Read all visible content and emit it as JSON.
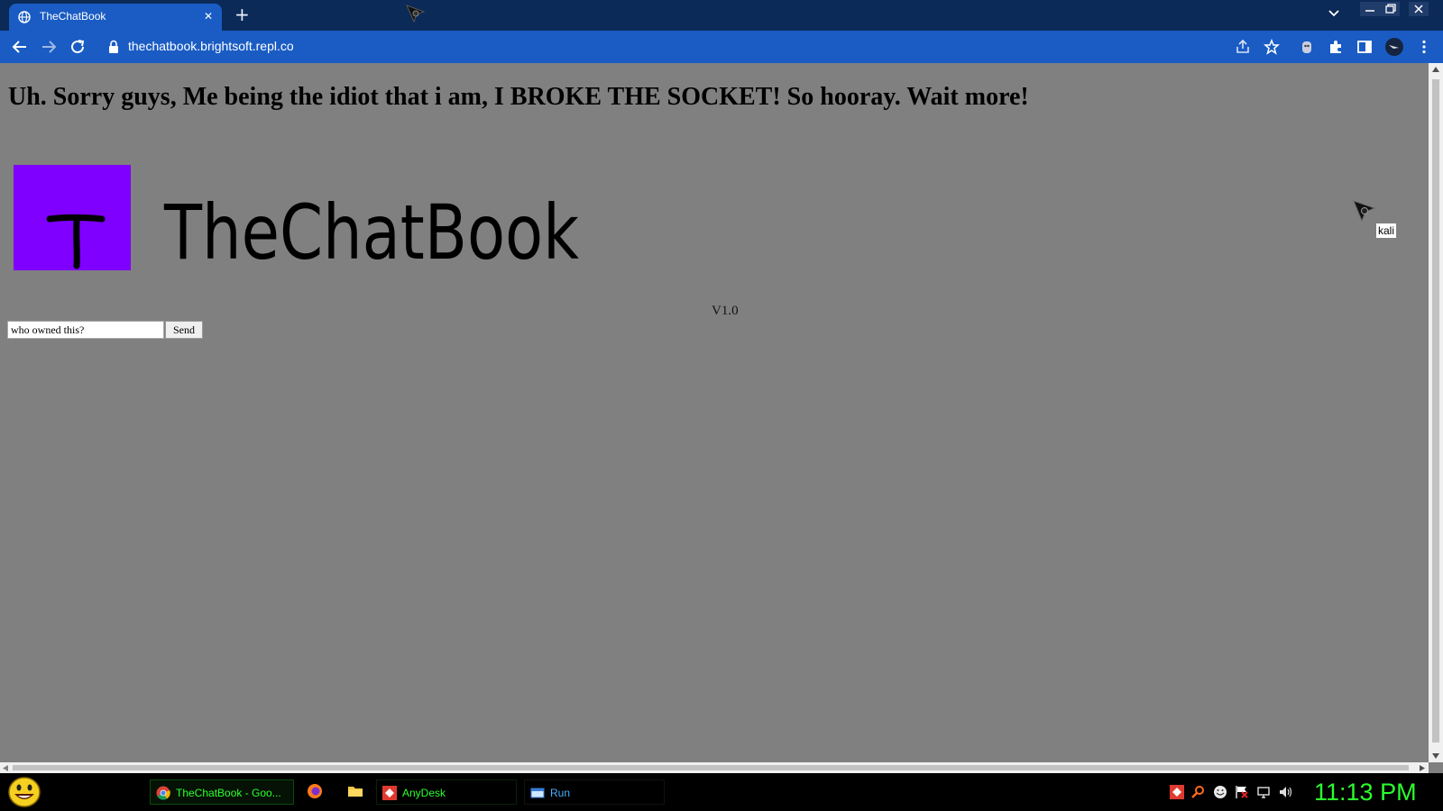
{
  "browser": {
    "tab": {
      "title": "TheChatBook",
      "favicon": "globe-icon",
      "close_icon": "close-icon"
    },
    "new_tab_icon": "plus-icon",
    "address": {
      "url": "thechatbook.brightsoft.repl.co",
      "lock_icon": "lock-icon"
    },
    "nav_icons": [
      "back-arrow-icon",
      "forward-arrow-icon",
      "reload-icon"
    ],
    "toolbar_icons": [
      "share-icon",
      "bookmark-star-icon",
      "extension-mascot-icon",
      "puzzle-extensions-icon",
      "side-panel-icon",
      "profile-avatar-icon",
      "more-menu-icon"
    ],
    "window_controls": [
      "minimize-icon",
      "restore-icon",
      "close-window-icon"
    ],
    "accent_color": "#1a5cc4",
    "titlebar_color": "#0b2a57"
  },
  "page": {
    "headline": "Uh. Sorry guys, Me being the idiot that i am, I BROKE THE SOCKET! So hooray. Wait more!",
    "logo": {
      "letter": "T",
      "wordmark": "TheChatBook",
      "box_color": "#7f00ff"
    },
    "version": "V1.0",
    "chat_input_value": "who owned this?",
    "send_label": "Send",
    "remote_cursor_label": "kali",
    "background_color": "#808080"
  },
  "taskbar": {
    "start_icon": "smiley-start-icon",
    "items": [
      {
        "label": "TheChatBook - Goo...",
        "icon": "chrome-icon"
      },
      {
        "label": "AnyDesk",
        "icon": "anydesk-icon"
      },
      {
        "label": "Run",
        "icon": "run-icon"
      }
    ],
    "pinned_icons": [
      "firefox-icon",
      "folder-icon"
    ],
    "tray_icons": [
      "anydesk-tray-icon",
      "search-tray-icon",
      "smiley-tray-icon",
      "flag-tray-icon",
      "network-tray-icon",
      "volume-tray-icon"
    ],
    "clock": "11:13 PM",
    "clock_color": "#2cff2c"
  }
}
